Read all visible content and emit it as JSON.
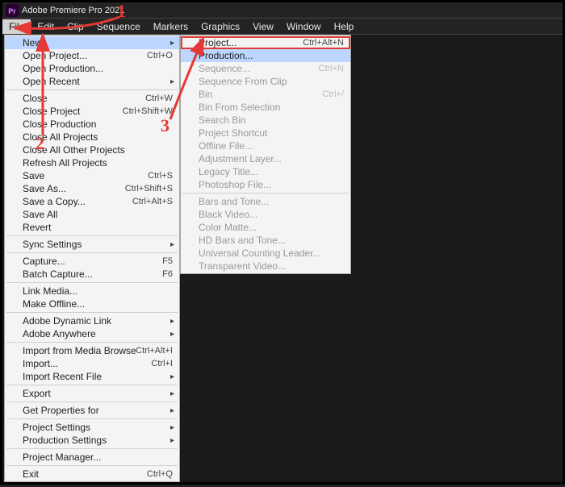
{
  "app": {
    "title": "Adobe Premiere Pro 2021"
  },
  "menubar": [
    "File",
    "Edit",
    "Clip",
    "Sequence",
    "Markers",
    "Graphics",
    "View",
    "Window",
    "Help"
  ],
  "fileMenu": [
    {
      "type": "item",
      "label": "New",
      "shortcut": "",
      "arrow": true,
      "hover": true
    },
    {
      "type": "item",
      "label": "Open Project...",
      "shortcut": "Ctrl+O"
    },
    {
      "type": "item",
      "label": "Open Production..."
    },
    {
      "type": "item",
      "label": "Open Recent",
      "arrow": true
    },
    {
      "type": "sep"
    },
    {
      "type": "item",
      "label": "Close",
      "shortcut": "Ctrl+W"
    },
    {
      "type": "item",
      "label": "Close Project",
      "shortcut": "Ctrl+Shift+W"
    },
    {
      "type": "item",
      "label": "Close Production"
    },
    {
      "type": "item",
      "label": "Close All Projects"
    },
    {
      "type": "item",
      "label": "Close All Other Projects"
    },
    {
      "type": "item",
      "label": "Refresh All Projects"
    },
    {
      "type": "item",
      "label": "Save",
      "shortcut": "Ctrl+S"
    },
    {
      "type": "item",
      "label": "Save As...",
      "shortcut": "Ctrl+Shift+S"
    },
    {
      "type": "item",
      "label": "Save a Copy...",
      "shortcut": "Ctrl+Alt+S"
    },
    {
      "type": "item",
      "label": "Save All"
    },
    {
      "type": "item",
      "label": "Revert"
    },
    {
      "type": "sep"
    },
    {
      "type": "item",
      "label": "Sync Settings",
      "arrow": true
    },
    {
      "type": "sep"
    },
    {
      "type": "item",
      "label": "Capture...",
      "shortcut": "F5"
    },
    {
      "type": "item",
      "label": "Batch Capture...",
      "shortcut": "F6"
    },
    {
      "type": "sep"
    },
    {
      "type": "item",
      "label": "Link Media..."
    },
    {
      "type": "item",
      "label": "Make Offline..."
    },
    {
      "type": "sep"
    },
    {
      "type": "item",
      "label": "Adobe Dynamic Link",
      "arrow": true
    },
    {
      "type": "item",
      "label": "Adobe Anywhere",
      "arrow": true
    },
    {
      "type": "sep"
    },
    {
      "type": "item",
      "label": "Import from Media Browser",
      "shortcut": "Ctrl+Alt+I"
    },
    {
      "type": "item",
      "label": "Import...",
      "shortcut": "Ctrl+I"
    },
    {
      "type": "item",
      "label": "Import Recent File",
      "arrow": true
    },
    {
      "type": "sep"
    },
    {
      "type": "item",
      "label": "Export",
      "arrow": true
    },
    {
      "type": "sep"
    },
    {
      "type": "item",
      "label": "Get Properties for",
      "arrow": true
    },
    {
      "type": "sep"
    },
    {
      "type": "item",
      "label": "Project Settings",
      "arrow": true
    },
    {
      "type": "item",
      "label": "Production Settings",
      "arrow": true
    },
    {
      "type": "sep"
    },
    {
      "type": "item",
      "label": "Project Manager..."
    },
    {
      "type": "sep"
    },
    {
      "type": "item",
      "label": "Exit",
      "shortcut": "Ctrl+Q"
    }
  ],
  "newSubMenu": [
    {
      "type": "item",
      "label": "Project...",
      "shortcut": "Ctrl+Alt+N",
      "highlight": true
    },
    {
      "type": "item",
      "label": "Production...",
      "hover": true
    },
    {
      "type": "item",
      "label": "Sequence...",
      "shortcut": "Ctrl+N",
      "disabled": true
    },
    {
      "type": "item",
      "label": "Sequence From Clip",
      "disabled": true
    },
    {
      "type": "item",
      "label": "Bin",
      "shortcut": "Ctrl+/",
      "disabled": true
    },
    {
      "type": "item",
      "label": "Bin From Selection",
      "disabled": true
    },
    {
      "type": "item",
      "label": "Search Bin",
      "disabled": true
    },
    {
      "type": "item",
      "label": "Project Shortcut",
      "disabled": true
    },
    {
      "type": "item",
      "label": "Offline File...",
      "disabled": true
    },
    {
      "type": "item",
      "label": "Adjustment Layer...",
      "disabled": true
    },
    {
      "type": "item",
      "label": "Legacy Title...",
      "disabled": true
    },
    {
      "type": "item",
      "label": "Photoshop File...",
      "disabled": true
    },
    {
      "type": "sep"
    },
    {
      "type": "item",
      "label": "Bars and Tone...",
      "disabled": true
    },
    {
      "type": "item",
      "label": "Black Video...",
      "disabled": true
    },
    {
      "type": "item",
      "label": "Color Matte...",
      "disabled": true
    },
    {
      "type": "item",
      "label": "HD Bars and Tone...",
      "disabled": true
    },
    {
      "type": "item",
      "label": "Universal Counting Leader...",
      "disabled": true
    },
    {
      "type": "item",
      "label": "Transparent Video...",
      "disabled": true
    }
  ],
  "callouts": {
    "one": "1",
    "two": "2",
    "three": "3"
  }
}
